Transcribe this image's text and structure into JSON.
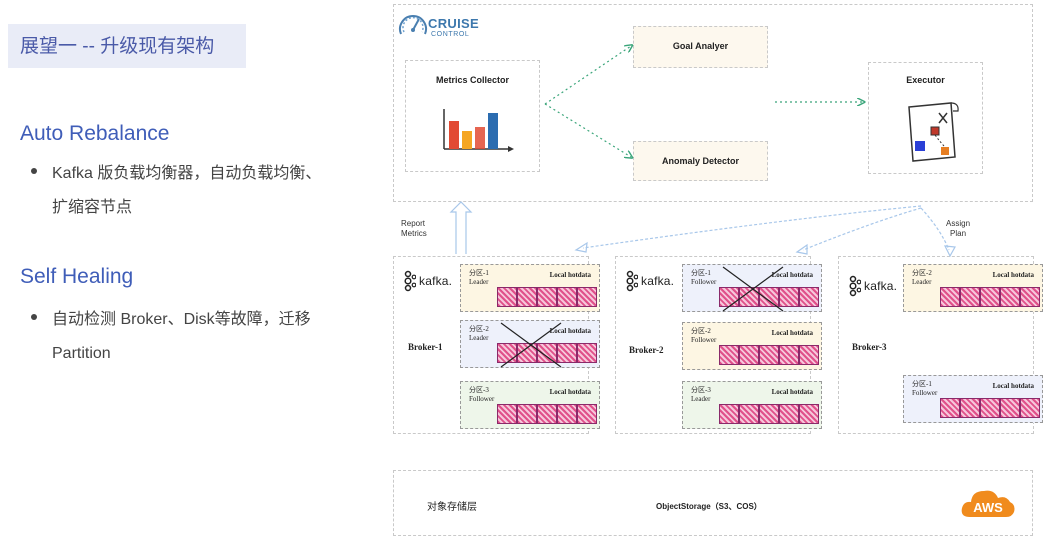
{
  "slide": {
    "title": "展望一 -- 升级现有架构",
    "sections": [
      {
        "heading": "Auto Rebalance",
        "bullet_line1": "Kafka 版负载均衡器，自动负载均衡、",
        "bullet_line2": "扩缩容节点"
      },
      {
        "heading": "Self Healing",
        "bullet_line1": "自动检测 Broker、Disk等故障，迁移",
        "bullet_line2": "Partition"
      }
    ]
  },
  "diagram": {
    "cruise_logo_line1": "CRUISE",
    "cruise_logo_line2": "CONTROL",
    "metrics_collector": "Metrics Collector",
    "goal_analyzer": "Goal Analyer",
    "anomaly_detector": "Anomaly Detector",
    "executor": "Executor",
    "report_metrics": "Report\nMetrics",
    "assign_plan": "Assign\nPlan",
    "kafka_label": "kafka.",
    "brokers": [
      {
        "name": "Broker-1",
        "partitions": [
          {
            "name": "分区-1",
            "role": "Leader",
            "label": "Local hotdata",
            "color": "orange",
            "crossed": false
          },
          {
            "name": "分区-2",
            "role": "Leader",
            "label": "Local hotdata",
            "color": "blue",
            "crossed": true
          },
          {
            "name": "分区-3",
            "role": "Follower",
            "label": "Local hotdata",
            "color": "green",
            "crossed": false
          }
        ]
      },
      {
        "name": "Broker-2",
        "partitions": [
          {
            "name": "分区-1",
            "role": "Follower",
            "label": "Local hotdata",
            "color": "blue",
            "crossed": true
          },
          {
            "name": "分区-2",
            "role": "Follower",
            "label": "Local hotdata",
            "color": "orange",
            "crossed": false
          },
          {
            "name": "分区-3",
            "role": "Leader",
            "label": "Local hotdata",
            "color": "green",
            "crossed": false
          }
        ]
      },
      {
        "name": "Broker-3",
        "partitions": [
          {
            "name": "分区-2",
            "role": "Leader",
            "label": "Local hotdata",
            "color": "orange",
            "crossed": false
          },
          {
            "name": "分区-1",
            "role": "Follower",
            "label": "Local hotdata",
            "color": "blue",
            "crossed": false
          }
        ]
      }
    ],
    "storage_layer": "对象存储层",
    "object_storage": "ObjectStorage（S3、COS）",
    "aws": "AWS"
  },
  "colors": {
    "title": "#4a5aa8",
    "heading": "#3f5db8",
    "arrow_green": "#3aa57a",
    "arrow_blue": "#a8c7ea",
    "bar_red": "#e24a33",
    "bar_orange": "#f5a623",
    "bar_blue": "#2b6cb0",
    "aws_orange": "#f08b1d"
  }
}
